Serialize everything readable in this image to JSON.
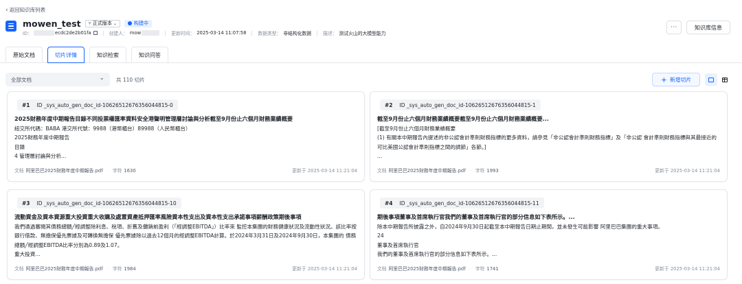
{
  "nav": {
    "back_label": "返回知识库列表"
  },
  "header": {
    "title": "mowen_test",
    "version_label": "正式版本",
    "status_label": "构建中",
    "id_label": "ID：",
    "id_value": "ecdc2de2b01fa",
    "creator_label": "创建人：",
    "creator_value": "mow",
    "updated_label": "更新时间：",
    "updated_value": "2025-03-14 11:07:58",
    "data_type_label": "数据类型：",
    "data_type_value": "非结构化数据",
    "desc_label": "描述：",
    "desc_value": "测试火山的大模型能力",
    "more_label": "···",
    "info_button_label": "知识库信息"
  },
  "tabs": [
    {
      "label": "原始文档"
    },
    {
      "label": "切片详情"
    },
    {
      "label": "知识检索"
    },
    {
      "label": "知识问答"
    }
  ],
  "toolbar": {
    "doc_filter_value": "全部文档",
    "total_text": "共 110 切片",
    "add_button_label": "新增切片"
  },
  "cards": [
    {
      "num": "#1",
      "doc_id": "ID _sys_auto_gen_doc_id-10626512676356044815-0",
      "title": "2025財務年度中期報告目錄不同投票權匯率資料安全港聲明管理層討論與分析截至9月份止六個月財務業績概要",
      "lines": [
        "紐交所代碼：BABA 港交所代號：9988（港幣櫃台）89988（人民幣櫃台）",
        "2025財務年度中期報告",
        "目錄",
        "4 管理層討論與分析..."
      ],
      "doc_label": "文档",
      "doc_name": "阿里巴巴2025財務年度中期報告.pdf",
      "chars_label": "字符",
      "chars": "1630",
      "updated_label": "更新于",
      "updated": "2025-03-14 11:21:04"
    },
    {
      "num": "#2",
      "doc_id": "ID _sys_auto_gen_doc_id-10626512676356044815-1",
      "title": "截至9月份止六個月財務業績概要截至9月份止六個月財務業績概要...",
      "lines": [
        "[截至9月份止六個月財務業績概要",
        "(1) 有關本中期報告內提述的非公認會計準則財務指標的更多資料，請參見「非公認會計準則財務指標」及「非公認 會計準則財務指標與其最接近的可比美國公認會計準則指標之間的調節」各節。]",
        "..."
      ],
      "doc_label": "文档",
      "doc_name": "阿里巴巴2025財務年度中期報告.pdf",
      "chars_label": "字符",
      "chars": "1993",
      "updated_label": "更新于",
      "updated": "2025-03-14 11:21:04"
    },
    {
      "num": "#3",
      "doc_id": "ID _sys_auto_gen_doc_id-10626512676356044815-10",
      "title": "流動資金及資本資源重大投資重大收購及處置資產抵押匯率風險資本性支出及資本性支出承諾事項薪酬政策期後事項",
      "lines": [
        "我們通過審閱其債務總額╱經調整除利息、稅項、折舊及攤銷前盈利（「經調整EBITDA」）比率來 監控本集團的財務健康狀況及流動性狀況。該比率按銀行借款、無擔保優先票據及可轉換無擔保 優先票據除以過去12個月的經調整EBITDA計算。於2024年3月31日及2024年9月30日，本集團的 債務總額╱經調整EBITDA比率分別為0.89及1.07。",
        "重大投資..."
      ],
      "doc_label": "文档",
      "doc_name": "阿里巴巴2025財務年度中期報告.pdf",
      "chars_label": "字符",
      "chars": "1984",
      "updated_label": "更新于",
      "updated": "2025-03-14 11:21:04"
    },
    {
      "num": "#4",
      "doc_id": "ID _sys_auto_gen_doc_id-10626512676356044815-11",
      "title": "期後事項董事及首席執行官我們的董事及首席執行官的部分信息如下表所示。...",
      "lines": [
        "除本中期報告所披露之外，自2024年9月30日起截至本中期報告日期止期間，並未發生可能影響 阿里巴巴集團的重大事項。",
        "24",
        "董事及首席執行官",
        "我們的董事及首席執行官的部分信息如下表所示。..."
      ],
      "doc_label": "文档",
      "doc_name": "阿里巴巴2025財務年度中期報告.pdf",
      "chars_label": "字符",
      "chars": "1741",
      "updated_label": "更新于",
      "updated": "2025-03-14 11:21:04"
    }
  ]
}
